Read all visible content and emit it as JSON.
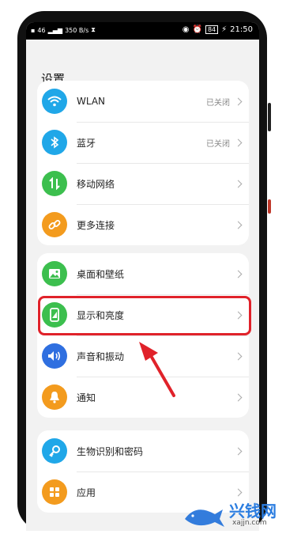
{
  "statusbar": {
    "left_text": "46",
    "speed": "350 B/s",
    "time": "21:50",
    "battery": "84"
  },
  "header": {
    "title": "设置"
  },
  "groups": [
    {
      "items": [
        {
          "label": "WLAN",
          "status": "已关闭",
          "icon": "wifi-icon",
          "color": "#20a7e8"
        },
        {
          "label": "蓝牙",
          "status": "已关闭",
          "icon": "bluetooth-icon",
          "color": "#20a7e8"
        },
        {
          "label": "移动网络",
          "status": "",
          "icon": "mobile-data-icon",
          "color": "#3cbf4e"
        },
        {
          "label": "更多连接",
          "status": "",
          "icon": "link-icon",
          "color": "#f39b1e"
        }
      ]
    },
    {
      "items": [
        {
          "label": "桌面和壁纸",
          "status": "",
          "icon": "wallpaper-icon",
          "color": "#3cbf4e"
        },
        {
          "label": "显示和亮度",
          "status": "",
          "icon": "phone-display-icon",
          "color": "#3cbf4e"
        },
        {
          "label": "声音和振动",
          "status": "",
          "icon": "speaker-icon",
          "color": "#2f6fe0"
        },
        {
          "label": "通知",
          "status": "",
          "icon": "bell-icon",
          "color": "#f39b1e"
        }
      ]
    },
    {
      "items": [
        {
          "label": "生物识别和密码",
          "status": "",
          "icon": "key-icon",
          "color": "#20a7e8"
        },
        {
          "label": "应用",
          "status": "",
          "icon": "apps-icon",
          "color": "#f39b1e"
        }
      ]
    }
  ],
  "annotation": {
    "color": "#e0222a"
  },
  "watermark": {
    "brand": "兴钱网",
    "url": "xajjn.com"
  }
}
